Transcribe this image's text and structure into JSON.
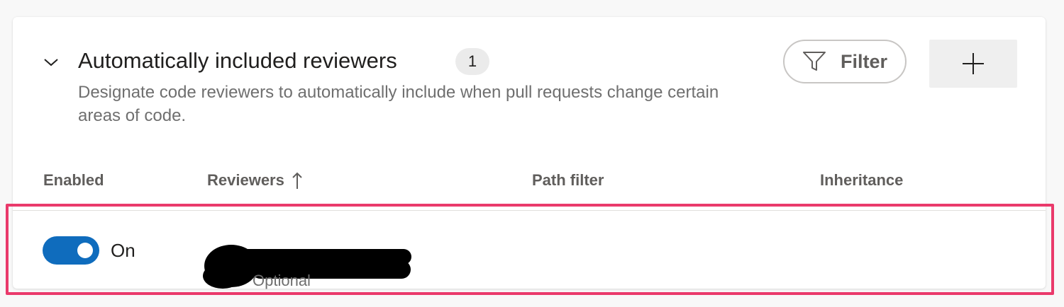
{
  "section": {
    "title": "Automatically included reviewers",
    "count": "1",
    "description": "Designate code reviewers to automatically include when pull requests change certain areas of code.",
    "collapse_icon": "chevron-down-icon"
  },
  "toolbar": {
    "filter_label": "Filter",
    "filter_icon": "filter-icon",
    "add_icon": "plus-icon"
  },
  "table": {
    "columns": [
      "Enabled",
      "Reviewers",
      "Path filter",
      "Inheritance"
    ],
    "sort_column": "Reviewers",
    "sort_direction": "ascending",
    "rows": [
      {
        "enabled": true,
        "enabled_label": "On",
        "reviewer_role": "Optional",
        "path_filter": "",
        "inheritance": ""
      }
    ]
  },
  "colors": {
    "toggle_on": "#0f6cbd",
    "highlight": "#ea3a6b"
  }
}
